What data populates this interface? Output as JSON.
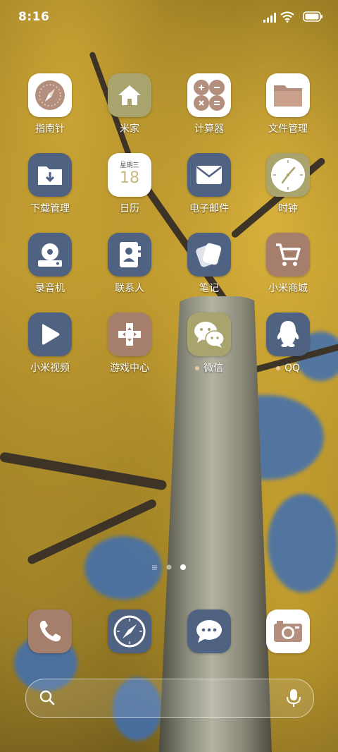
{
  "status_bar": {
    "time": "8:16"
  },
  "apps": [
    {
      "label": "指南针",
      "icon": "compass-icon",
      "bg": "#ffffff"
    },
    {
      "label": "米家",
      "icon": "home-icon",
      "bg": "#a9a46d"
    },
    {
      "label": "计算器",
      "icon": "calculator-icon",
      "bg": "#ffffff"
    },
    {
      "label": "文件管理",
      "icon": "folder-icon",
      "bg": "#ffffff"
    },
    {
      "label": "下载管理",
      "icon": "download-folder-icon",
      "bg": "#4f6282"
    },
    {
      "label": "日历",
      "icon": "calendar-icon",
      "bg": "#ffffff",
      "weekday": "星期三",
      "day": "18"
    },
    {
      "label": "电子邮件",
      "icon": "mail-icon",
      "bg": "#4f6282"
    },
    {
      "label": "时钟",
      "icon": "clock-icon",
      "bg": "#a9a46d"
    },
    {
      "label": "录音机",
      "icon": "recorder-icon",
      "bg": "#4f6282"
    },
    {
      "label": "联系人",
      "icon": "contacts-icon",
      "bg": "#4f6282"
    },
    {
      "label": "笔记",
      "icon": "notes-icon",
      "bg": "#4f6282"
    },
    {
      "label": "小米商城",
      "icon": "cart-icon",
      "bg": "#a67f6c"
    },
    {
      "label": "小米视频",
      "icon": "play-icon",
      "bg": "#4f6282"
    },
    {
      "label": "游戏中心",
      "icon": "gamepad-icon",
      "bg": "#a67f6c"
    },
    {
      "label": "微信",
      "icon": "wechat-icon",
      "bg": "#a9a46d",
      "new_dot": true
    },
    {
      "label": "QQ",
      "icon": "qq-penguin-icon",
      "bg": "#4f6282",
      "new_dot": true
    }
  ],
  "dock": [
    {
      "icon": "phone-icon",
      "bg": "#a67f6c"
    },
    {
      "icon": "browser-compass-icon",
      "bg": "#4f6282"
    },
    {
      "icon": "message-icon",
      "bg": "#4f6282"
    },
    {
      "icon": "camera-icon",
      "bg": "#ffffff"
    }
  ],
  "pager": {
    "pages": 2,
    "current": 2
  },
  "search": {
    "placeholder": ""
  }
}
